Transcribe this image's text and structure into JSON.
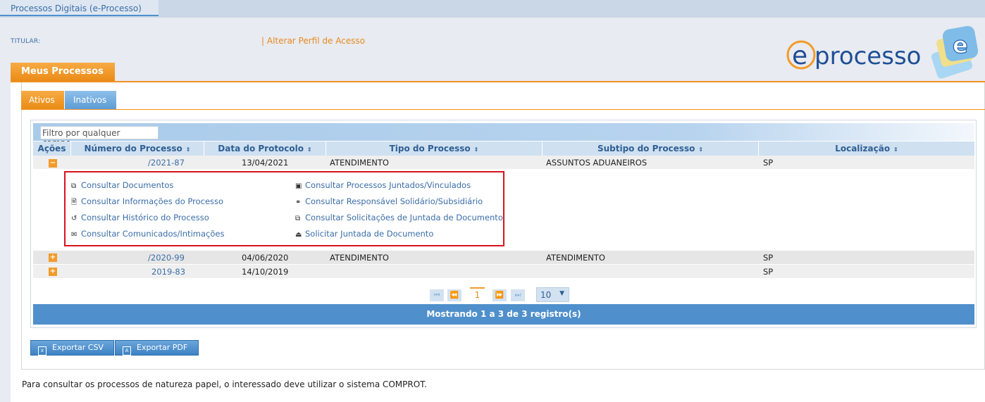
{
  "topbar": {
    "title": "Processos Digitais (e-Processo)"
  },
  "header": {
    "titular_label": "TITULAR:",
    "sep": "|",
    "alterar_perfil": "Alterar Perfil de Acesso",
    "logo_text": "eprocesso"
  },
  "meus_processos_tab": "Meus Processos",
  "tabs": {
    "ativos": "Ativos",
    "inativos": "Inativos"
  },
  "filter": {
    "placeholder": "Filtro por qualquer campo..."
  },
  "columns": {
    "acoes": "Ações",
    "numero": "Número do Processo",
    "data": "Data do Protocolo",
    "tipo": "Tipo do Processo",
    "subtipo": "Subtipo do Processo",
    "localizacao": "Localização",
    "sort_icon": "⇕"
  },
  "rows": [
    {
      "toggle": "−",
      "numero": "/2021-87",
      "data": "13/04/2021",
      "tipo": "ATENDIMENTO",
      "subtipo": "ASSUNTOS ADUANEIROS",
      "localizacao": "SP"
    },
    {
      "toggle": "+",
      "numero": "/2020-99",
      "data": "04/06/2020",
      "tipo": "ATENDIMENTO",
      "subtipo": "ATENDIMENTO",
      "localizacao": "SP"
    },
    {
      "toggle": "+",
      "numero": "2019-83",
      "data": "14/10/2019",
      "tipo": "",
      "subtipo": "",
      "localizacao": "SP"
    }
  ],
  "actions": {
    "consultar_documentos": "Consultar Documentos",
    "consultar_informacoes": "Consultar Informações do Processo",
    "consultar_historico": "Consultar Histórico do Processo",
    "consultar_comunicados": "Consultar Comunicados/Intimações",
    "consultar_juntados": "Consultar Processos Juntados/Vinculados",
    "consultar_responsavel": "Consultar Responsável Solidário/Subsidiário",
    "consultar_solicitacoes": "Consultar Solicitações de Juntada de Documento",
    "solicitar_juntada": "Solicitar Juntada de Documento"
  },
  "pager": {
    "current_page": "1",
    "page_size": "10"
  },
  "summary": "Mostrando 1 a 3 de 3 registro(s)",
  "export": {
    "csv": "Exportar CSV",
    "pdf": "Exportar PDF"
  },
  "note": "Para consultar os processos de natureza papel, o interessado deve utilizar o sistema COMPROT.",
  "colors": {
    "orange": "#f29b2b",
    "blue": "#4f8fcb",
    "link": "#3a6ea8",
    "highlight_red": "#d7141e"
  }
}
